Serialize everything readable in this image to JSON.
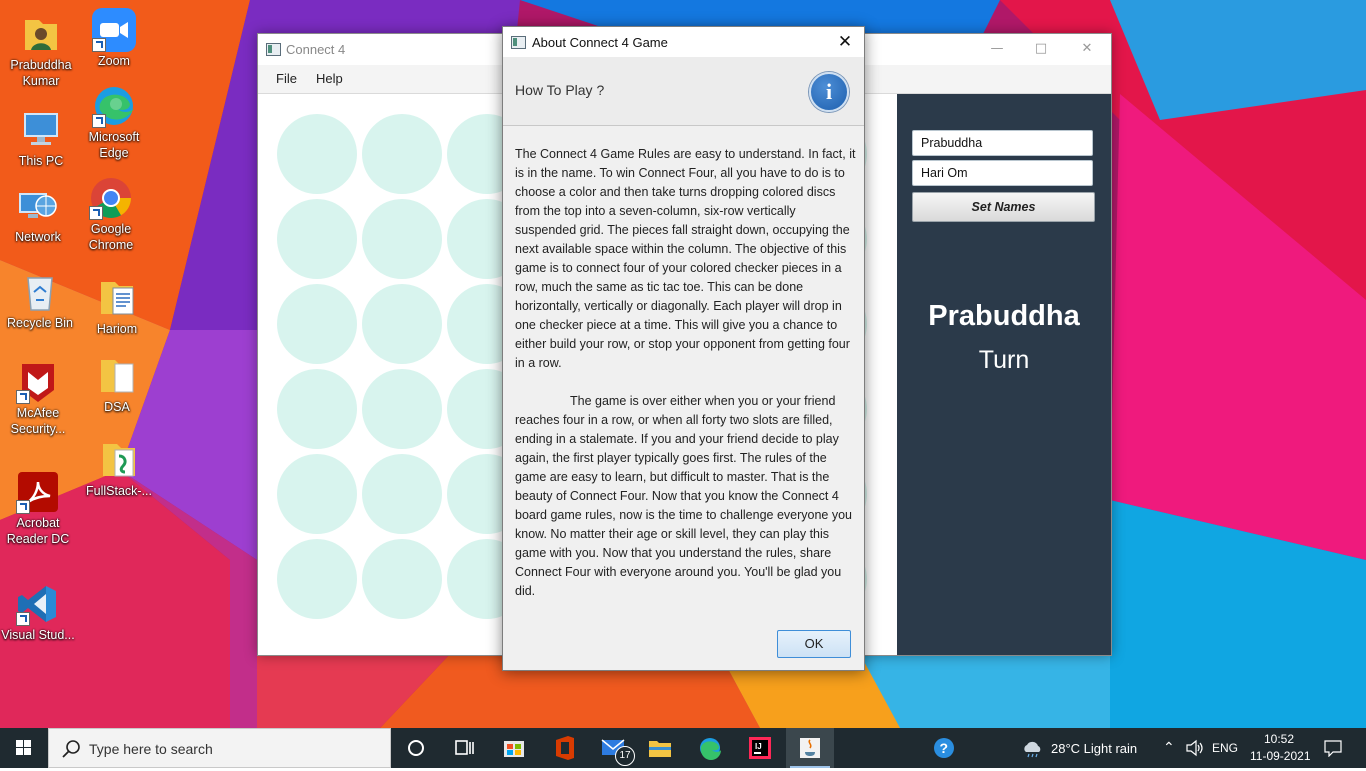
{
  "desktop": {
    "icons": [
      {
        "label": "Prabuddha Kumar",
        "icon": "user-folder-icon"
      },
      {
        "label": "Zoom",
        "icon": "zoom-icon"
      },
      {
        "label": "This PC",
        "icon": "computer-icon"
      },
      {
        "label": "Microsoft Edge",
        "icon": "edge-icon"
      },
      {
        "label": "Network",
        "icon": "network-icon"
      },
      {
        "label": "Google Chrome",
        "icon": "chrome-icon"
      },
      {
        "label": "Recycle Bin",
        "icon": "recycle-bin-icon"
      },
      {
        "label": "Hariom",
        "icon": "document-icon"
      },
      {
        "label": "McAfee Security...",
        "icon": "mcafee-icon"
      },
      {
        "label": "DSA",
        "icon": "folder-icon"
      },
      {
        "label": "Acrobat Reader DC",
        "icon": "acrobat-icon"
      },
      {
        "label": "FullStack-...",
        "icon": "folder-icon"
      },
      {
        "label": "Visual Stud...",
        "icon": "vscode-icon"
      }
    ]
  },
  "app": {
    "title": "Connect 4",
    "menu": [
      "File",
      "Help"
    ],
    "rows": 6,
    "columns": 7,
    "cell_color": "#d8f4ee",
    "panel_color": "#2b3a4a",
    "player1": "Prabuddha",
    "player2": "Hari Om",
    "set_names_label": "Set Names",
    "current_player": "Prabuddha",
    "turn_label": "Turn"
  },
  "dialog": {
    "title": "About Connect 4 Game",
    "close_label": "✕",
    "heading": "How To Play ?",
    "info_glyph": "i",
    "paragraph1": "The Connect 4 Game Rules are easy to understand. In fact, it is in the name. To win Connect Four, all you have to do is to choose a color and then take turns dropping colored discs from the top into a seven-column, six-row vertically suspended grid. The pieces fall straight down, occupying the next available space within the column. The objective of this game is to connect four of your colored checker pieces in a row, much the same as tic tac toe. This can be done horizontally, vertically or diagonally. Each player will drop in one checker piece at a time. This will give you a chance to either build your row, or stop your opponent from getting four in a row.",
    "paragraph2": "The game is over either when you or your friend reaches four in a row, or when all forty two slots are filled, ending in a stalemate. If you and your friend decide to play again, the first player typically goes first. The rules of the game are easy to learn, but difficult to master. That is the beauty of Connect Four. Now that you know the Connect 4 board game rules, now is the time to challenge everyone you know. No matter their age or skill level, they can play this game with you. Now that you understand the rules, share Connect Four with everyone around you. You'll be glad you did.",
    "ok_label": "OK"
  },
  "taskbar": {
    "search_placeholder": "Type here to search",
    "apps": [
      "task-view-icon",
      "store-icon",
      "office-icon",
      "mail-icon",
      "file-explorer-icon",
      "edge-icon",
      "intellij-icon",
      "java-icon"
    ],
    "mail_badge": "17",
    "weather": "28°C  Light rain",
    "language": "ENG",
    "time": "10:52",
    "date": "11-09-2021"
  }
}
